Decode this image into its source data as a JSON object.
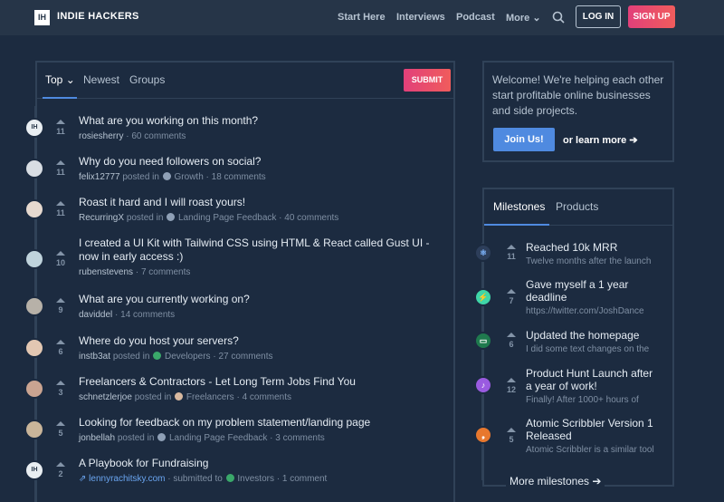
{
  "header": {
    "logo": "IH",
    "brand": "INDIE HACKERS",
    "nav": [
      "Start Here",
      "Interviews",
      "Podcast",
      "More"
    ],
    "login": "LOG IN",
    "signup": "SIGN UP"
  },
  "feed": {
    "tabs": [
      "Top",
      "Newest",
      "Groups"
    ],
    "submit": "SUBMIT",
    "posts": [
      {
        "title": "What are you working on this month?",
        "votes": "11",
        "author": "rosiesherry",
        "posted_in": "",
        "group": "",
        "comments": "60 comments"
      },
      {
        "title": "Why do you need followers on social?",
        "votes": "11",
        "author": "felix12777",
        "posted_in": "posted in",
        "group": "Growth",
        "comments": "18 comments"
      },
      {
        "title": "Roast it hard and I will roast yours!",
        "votes": "11",
        "author": "RecurringX",
        "posted_in": "posted in",
        "group": "Landing Page Feedback",
        "comments": "40 comments"
      },
      {
        "title": "I created a UI Kit with Tailwind CSS using HTML & React called Gust UI - now in early access :)",
        "votes": "10",
        "author": "rubenstevens",
        "posted_in": "",
        "group": "",
        "comments": "7 comments"
      },
      {
        "title": "What are you currently working on?",
        "votes": "9",
        "author": "daviddel",
        "posted_in": "",
        "group": "",
        "comments": "14 comments"
      },
      {
        "title": "Where do you host your servers?",
        "votes": "6",
        "author": "instb3at",
        "posted_in": "posted in",
        "group": "Developers",
        "comments": "27 comments"
      },
      {
        "title": "Freelancers & Contractors - Let Long Term Jobs Find You",
        "votes": "3",
        "author": "schnetzlerjoe",
        "posted_in": "posted in",
        "group": "Freelancers",
        "comments": "4 comments"
      },
      {
        "title": "Looking for feedback on my problem statement/landing page",
        "votes": "5",
        "author": "jonbellah",
        "posted_in": "posted in",
        "group": "Landing Page Feedback",
        "comments": "3 comments"
      },
      {
        "title": "A Playbook for Fundraising",
        "votes": "2",
        "author": "lennyrachitsky.com",
        "posted_in": "submitted to",
        "group": "Investors",
        "comments": "1 comment"
      }
    ]
  },
  "welcome": {
    "text": "Welcome! We're helping each other start profitable online businesses and side projects.",
    "join": "Join Us!",
    "learn": "or learn more"
  },
  "milestones": {
    "tabs": [
      "Milestones",
      "Products"
    ],
    "items": [
      {
        "title": "Reached 10k MRR",
        "votes": "11",
        "sub": "Twelve months after the launch",
        "color": "#2d3e5a",
        "glyph": "⚛"
      },
      {
        "title": "Gave myself a 1 year deadline",
        "votes": "7",
        "sub": "https://twitter.com/JoshDance",
        "color": "#3fd6a8",
        "glyph": "⚡"
      },
      {
        "title": "Updated the homepage",
        "votes": "6",
        "sub": "I did some text changes on the",
        "color": "#1f7a4e",
        "glyph": "▭"
      },
      {
        "title": "Product Hunt Launch after a year of work!",
        "votes": "12",
        "sub": "Finally! After 1000+ hours of",
        "color": "#9a5be0",
        "glyph": "♪"
      },
      {
        "title": "Atomic Scribbler Version 1 Released",
        "votes": "5",
        "sub": "Atomic Scribbler is a similar tool",
        "color": "#e8782e",
        "glyph": "❟"
      }
    ],
    "more": "More milestones"
  }
}
